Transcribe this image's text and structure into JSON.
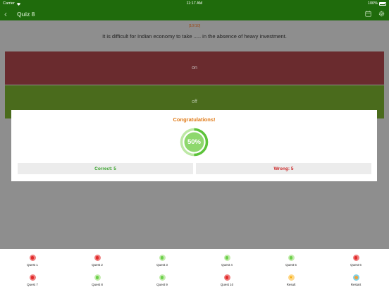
{
  "status_bar": {
    "carrier": "Carrier",
    "time": "11:17 AM",
    "battery": "100%"
  },
  "nav": {
    "title": "Quiz 8",
    "back_icon": "chevron-left-icon",
    "icons": [
      "calendar-icon",
      "gear-icon"
    ]
  },
  "question": {
    "count": "[10/10]",
    "text": "It is difficult for Indian economy to take ..... in the absence of heavy investment."
  },
  "options": [
    "on",
    "off"
  ],
  "results": {
    "title": "Congratulations!",
    "score_label": "50%",
    "score_fraction": 0.5,
    "correct_label": "Correct:  5",
    "wrong_label": "Wrong: 5"
  },
  "colors": {
    "nav_green": "#1f6b0c",
    "correct_green": "#3aa32d",
    "wrong_red": "#cc2a2a",
    "title_orange": "#e07a17"
  },
  "bottom_nav": [
    {
      "label": "Quest 1",
      "state": "wrong"
    },
    {
      "label": "Quest 2",
      "state": "wrong"
    },
    {
      "label": "Quest 3",
      "state": "correct"
    },
    {
      "label": "Quest 4",
      "state": "correct"
    },
    {
      "label": "Quest 5",
      "state": "correct"
    },
    {
      "label": "Quest 6",
      "state": "wrong"
    },
    {
      "label": "Quest 7",
      "state": "wrong"
    },
    {
      "label": "Quest 8",
      "state": "correct"
    },
    {
      "label": "Quest 9",
      "state": "correct"
    },
    {
      "label": "Quest 10",
      "state": "wrong"
    },
    {
      "label": "Result",
      "state": "result"
    },
    {
      "label": "Restart",
      "state": "restart"
    }
  ]
}
